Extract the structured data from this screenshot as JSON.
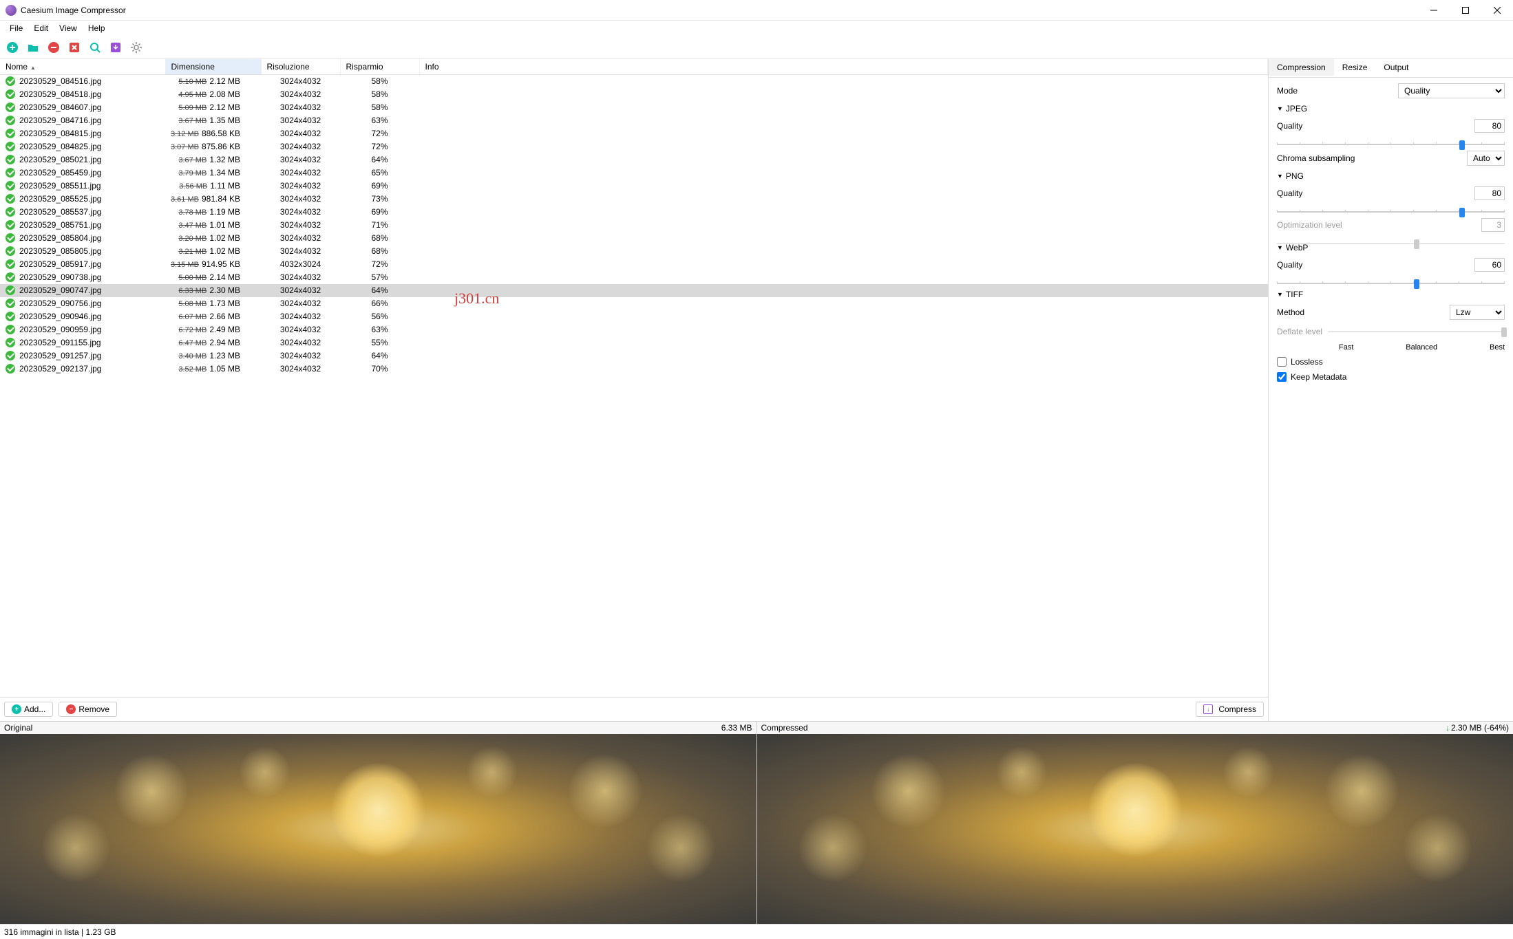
{
  "window": {
    "title": "Caesium Image Compressor"
  },
  "menubar": [
    "File",
    "Edit",
    "View",
    "Help"
  ],
  "columns": {
    "name": "Nome",
    "size": "Dimensione",
    "resolution": "Risoluzione",
    "savings": "Risparmio",
    "info": "Info"
  },
  "files": [
    {
      "name": "20230529_084516.jpg",
      "old": "5.10 MB",
      "new": "2.12 MB",
      "res": "3024x4032",
      "save": "58%",
      "sel": false
    },
    {
      "name": "20230529_084518.jpg",
      "old": "4.95 MB",
      "new": "2.08 MB",
      "res": "3024x4032",
      "save": "58%",
      "sel": false
    },
    {
      "name": "20230529_084607.jpg",
      "old": "5.09 MB",
      "new": "2.12 MB",
      "res": "3024x4032",
      "save": "58%",
      "sel": false
    },
    {
      "name": "20230529_084716.jpg",
      "old": "3.67 MB",
      "new": "1.35 MB",
      "res": "3024x4032",
      "save": "63%",
      "sel": false
    },
    {
      "name": "20230529_084815.jpg",
      "old": "3.12 MB",
      "new": "886.58 KB",
      "res": "3024x4032",
      "save": "72%",
      "sel": false
    },
    {
      "name": "20230529_084825.jpg",
      "old": "3.07 MB",
      "new": "875.86 KB",
      "res": "3024x4032",
      "save": "72%",
      "sel": false
    },
    {
      "name": "20230529_085021.jpg",
      "old": "3.67 MB",
      "new": "1.32 MB",
      "res": "3024x4032",
      "save": "64%",
      "sel": false
    },
    {
      "name": "20230529_085459.jpg",
      "old": "3.79 MB",
      "new": "1.34 MB",
      "res": "3024x4032",
      "save": "65%",
      "sel": false
    },
    {
      "name": "20230529_085511.jpg",
      "old": "3.56 MB",
      "new": "1.11 MB",
      "res": "3024x4032",
      "save": "69%",
      "sel": false
    },
    {
      "name": "20230529_085525.jpg",
      "old": "3.61 MB",
      "new": "981.84 KB",
      "res": "3024x4032",
      "save": "73%",
      "sel": false
    },
    {
      "name": "20230529_085537.jpg",
      "old": "3.78 MB",
      "new": "1.19 MB",
      "res": "3024x4032",
      "save": "69%",
      "sel": false
    },
    {
      "name": "20230529_085751.jpg",
      "old": "3.47 MB",
      "new": "1.01 MB",
      "res": "3024x4032",
      "save": "71%",
      "sel": false
    },
    {
      "name": "20230529_085804.jpg",
      "old": "3.20 MB",
      "new": "1.02 MB",
      "res": "3024x4032",
      "save": "68%",
      "sel": false
    },
    {
      "name": "20230529_085805.jpg",
      "old": "3.21 MB",
      "new": "1.02 MB",
      "res": "3024x4032",
      "save": "68%",
      "sel": false
    },
    {
      "name": "20230529_085917.jpg",
      "old": "3.15 MB",
      "new": "914.95 KB",
      "res": "4032x3024",
      "save": "72%",
      "sel": false
    },
    {
      "name": "20230529_090738.jpg",
      "old": "5.00 MB",
      "new": "2.14 MB",
      "res": "3024x4032",
      "save": "57%",
      "sel": false
    },
    {
      "name": "20230529_090747.jpg",
      "old": "6.33 MB",
      "new": "2.30 MB",
      "res": "3024x4032",
      "save": "64%",
      "sel": true
    },
    {
      "name": "20230529_090756.jpg",
      "old": "5.08 MB",
      "new": "1.73 MB",
      "res": "3024x4032",
      "save": "66%",
      "sel": false
    },
    {
      "name": "20230529_090946.jpg",
      "old": "6.07 MB",
      "new": "2.66 MB",
      "res": "3024x4032",
      "save": "56%",
      "sel": false
    },
    {
      "name": "20230529_090959.jpg",
      "old": "6.72 MB",
      "new": "2.49 MB",
      "res": "3024x4032",
      "save": "63%",
      "sel": false
    },
    {
      "name": "20230529_091155.jpg",
      "old": "6.47 MB",
      "new": "2.94 MB",
      "res": "3024x4032",
      "save": "55%",
      "sel": false
    },
    {
      "name": "20230529_091257.jpg",
      "old": "3.40 MB",
      "new": "1.23 MB",
      "res": "3024x4032",
      "save": "64%",
      "sel": false
    },
    {
      "name": "20230529_092137.jpg",
      "old": "3.52 MB",
      "new": "1.05 MB",
      "res": "3024x4032",
      "save": "70%",
      "sel": false
    }
  ],
  "watermark": "j301.cn",
  "buttons": {
    "add": "Add...",
    "remove": "Remove",
    "compress": "Compress"
  },
  "tabs": {
    "compression": "Compression",
    "resize": "Resize",
    "output": "Output"
  },
  "panel": {
    "mode_label": "Mode",
    "mode_value": "Quality",
    "jpeg": "JPEG",
    "png": "PNG",
    "webp": "WebP",
    "tiff": "TIFF",
    "quality": "Quality",
    "jpeg_q": "80",
    "png_q": "80",
    "webp_q": "60",
    "chroma_label": "Chroma subsampling",
    "chroma_value": "Auto",
    "opt_label": "Optimization level",
    "opt_value": "3",
    "method_label": "Method",
    "method_value": "Lzw",
    "deflate_label": "Deflate level",
    "fast": "Fast",
    "balanced": "Balanced",
    "best": "Best",
    "lossless": "Lossless",
    "keep_meta": "Keep Metadata"
  },
  "preview": {
    "original": "Original",
    "original_size": "6.33 MB",
    "compressed": "Compressed",
    "compressed_size": "2.30 MB (-64%)"
  },
  "status": "316 immagini in lista | 1.23 GB"
}
